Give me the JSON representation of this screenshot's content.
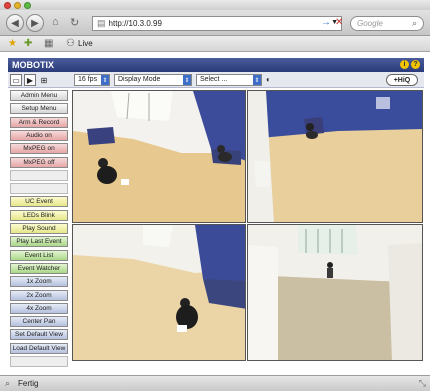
{
  "browser": {
    "url": "http://10.3.0.99",
    "search_placeholder": "Google",
    "bookmark_label": "Live",
    "status_text": "Fertig"
  },
  "app": {
    "brand": "MOBOTIX",
    "fps_select": "16 fps",
    "display_mode_select": "Display Mode",
    "select_select": "Select ...",
    "hiq_label": "+HiQ"
  },
  "sidebar": {
    "items": [
      {
        "label": "Admin Menu",
        "style": "grey"
      },
      {
        "label": "Setup Menu",
        "style": "grey"
      },
      {
        "label": "Arm & Record",
        "style": "red"
      },
      {
        "label": "Audio on",
        "style": "red"
      },
      {
        "label": "MxPEG on",
        "style": "red"
      },
      {
        "label": "MxPEG off",
        "style": "red"
      },
      {
        "label": "",
        "style": "empty"
      },
      {
        "label": "",
        "style": "empty"
      },
      {
        "label": "UC Event",
        "style": "yellow"
      },
      {
        "label": "LEDs Blink",
        "style": "yellow"
      },
      {
        "label": "Play Sound",
        "style": "yellow"
      },
      {
        "label": "Play Last Event",
        "style": "green"
      },
      {
        "label": "Event List",
        "style": "green"
      },
      {
        "label": "Event Watcher",
        "style": "green"
      },
      {
        "label": "1x Zoom",
        "style": "blue"
      },
      {
        "label": "2x Zoom",
        "style": "blue"
      },
      {
        "label": "4x Zoom",
        "style": "blue"
      },
      {
        "label": "Center Pan",
        "style": "blue"
      },
      {
        "label": "Set Default View",
        "style": "blue"
      },
      {
        "label": "Load Default View",
        "style": "blue"
      },
      {
        "label": "",
        "style": "empty"
      }
    ]
  }
}
